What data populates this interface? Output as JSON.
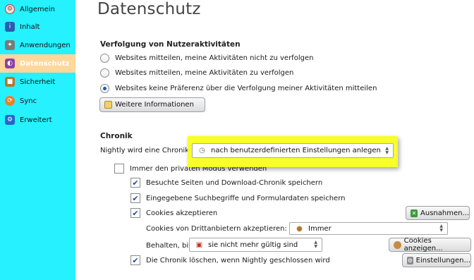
{
  "sidebar": {
    "items": [
      {
        "label": "Allgemein",
        "icon": "general-icon",
        "active": false
      },
      {
        "label": "Inhalt",
        "icon": "content-icon",
        "active": false
      },
      {
        "label": "Anwendungen",
        "icon": "applications-icon",
        "active": false
      },
      {
        "label": "Datenschutz",
        "icon": "privacy-mask-icon",
        "active": true
      },
      {
        "label": "Sicherheit",
        "icon": "security-lock-icon",
        "active": false
      },
      {
        "label": "Sync",
        "icon": "sync-icon",
        "active": false
      },
      {
        "label": "Erweitert",
        "icon": "gear-icon",
        "active": false
      }
    ]
  },
  "main": {
    "title": "Datenschutz",
    "tracking": {
      "heading": "Verfolgung von Nutzeraktivitäten",
      "options": [
        {
          "label": "Websites mitteilen, meine Aktivitäten nicht zu verfolgen",
          "checked": false
        },
        {
          "label": "Websites mitteilen, meine Aktivitäten zu verfolgen",
          "checked": false
        },
        {
          "label": "Websites keine Präferenz über die Verfolgung meiner Aktivitäten mitteilen",
          "checked": true
        }
      ],
      "more_info_button": "Weitere Informationen"
    },
    "history": {
      "heading": "Chronik",
      "mode_label": "Nightly wird eine Chronik: (F)",
      "mode_value": "nach benutzerdefinierten Einstellungen anlegen",
      "private_mode": {
        "label": "Immer den privaten Modus verwenden",
        "checked": false
      },
      "visited": {
        "label": "Besuchte Seiten und Download-Chronik speichern",
        "checked": true
      },
      "search_forms": {
        "label": "Eingegebene Suchbegriffe und Formulardaten speichern",
        "checked": true
      },
      "cookies": {
        "label": "Cookies akzeptieren",
        "checked": true
      },
      "exceptions_button": "Ausnahmen...",
      "third_party_label": "Cookies von Drittanbietern akzeptieren:",
      "third_party_value": "Immer",
      "keep_label": "Behalten, bis:",
      "keep_value": "sie nicht mehr gültig sind",
      "show_cookies_button": "Cookies anzeigen...",
      "clear_on_close": {
        "label": "Die Chronik löschen, wenn Nightly geschlossen wird",
        "checked": true
      },
      "settings_button": "Einstellungen..."
    }
  },
  "colors": {
    "sidebar_bg": "#26f1ff",
    "sidebar_active": "#ffd79a",
    "highlight": "#f8ff2a",
    "check": "#1c4c9e"
  }
}
